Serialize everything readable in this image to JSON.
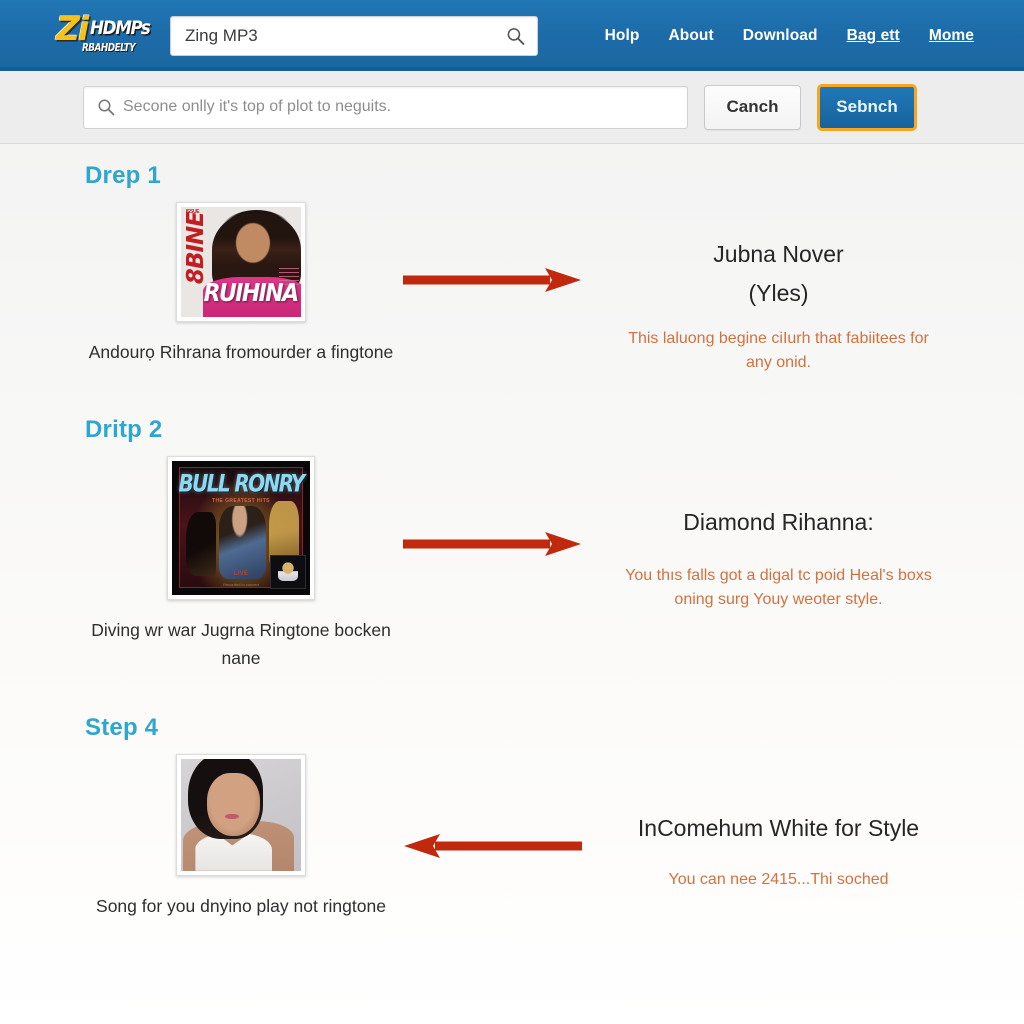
{
  "header": {
    "logo": {
      "part1": "Zi",
      "part2": "HDMPs",
      "part3": "RBAHDELTY"
    },
    "search": {
      "value": "Zing MP3",
      "placeholder": "Zing MP3",
      "icon": "search-icon"
    },
    "nav": [
      {
        "label": "Holp",
        "underlined": false
      },
      {
        "label": "About",
        "underlined": false
      },
      {
        "label": "Download",
        "underlined": false
      },
      {
        "label": "Bag ett",
        "underlined": true
      },
      {
        "label": "Mome",
        "underlined": true
      }
    ],
    "colors": {
      "background": "#1c6aa8",
      "accent_yellow": "#f5c21b",
      "text": "#ffffff"
    }
  },
  "searchbar": {
    "input": {
      "value": "",
      "placeholder": "Secone onlly it's top of plot to neguits.",
      "icon": "search-icon"
    },
    "cancel_label": "Canch",
    "search_label": "Sebnch",
    "colors": {
      "bar_background": "#ededed",
      "primary_button": "#1c6aa8",
      "focus_ring": "#f5a623"
    }
  },
  "steps": [
    {
      "label": "Drep 1",
      "caption": "Andourọ Rihrana fromourder a fingtone",
      "arrow_direction": "right",
      "thumbnail": {
        "kind": "magazine-cover",
        "side_text": "8BINE",
        "top_text": "ISSUE",
        "name_text": "RUIHINA"
      },
      "title": "Jubna Nover\n(Yles)",
      "title_line1": "Jubna Nover",
      "title_line2": "(Yles)",
      "description": "This laluong begine ciIurh that fabiitees for any onid."
    },
    {
      "label": "Dritp 2",
      "caption": "Diving wr war Jugrna Ringtone bocken nane",
      "arrow_direction": "right",
      "thumbnail": {
        "kind": "album-cover",
        "title_text": "BULL RONRY",
        "subtitle_text": "THE GREATEST HITS",
        "bottom_text": "LIVE",
        "bottom_text2": "Recorded in concert"
      },
      "title_line1": "Diamond Rihanna:",
      "title_line2": "",
      "description": "You thıs falls got a digal tc poid Heal's boxs oning surg Youy weoter style."
    },
    {
      "label": "Step 4",
      "caption": "Song for you dnyino play not ringtone",
      "arrow_direction": "left",
      "thumbnail": {
        "kind": "portrait-photo"
      },
      "title_line1": "InComehum White for Style",
      "title_line2": "",
      "description": "You can nee 2415...Thi soched"
    }
  ],
  "colors": {
    "step_label": "#2fa6cc",
    "arrow": "#c0290d",
    "description_text": "#d4713f",
    "page_background": "#f4f4f3"
  }
}
